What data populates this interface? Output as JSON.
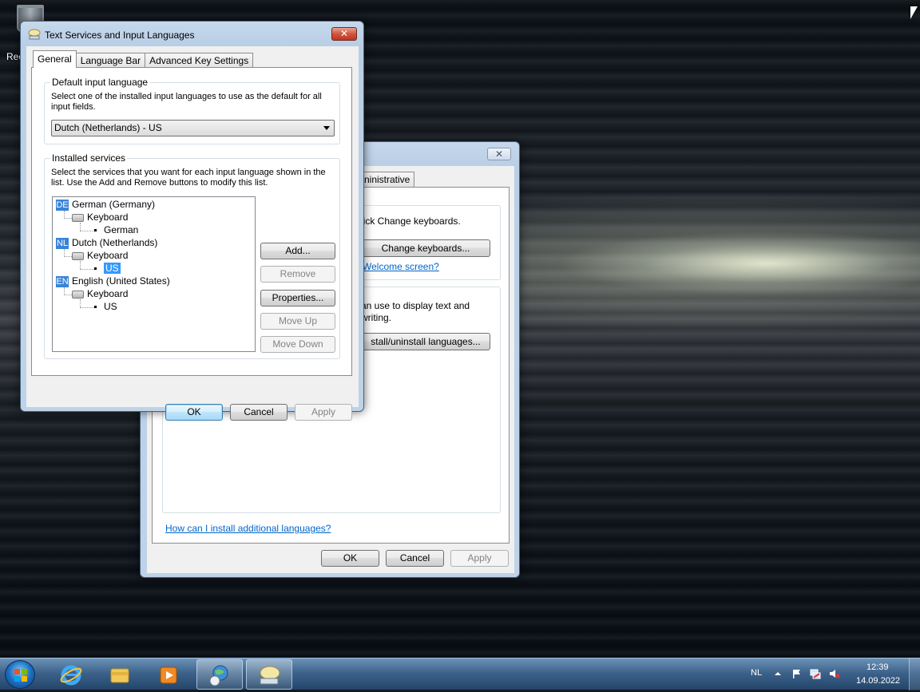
{
  "desktop": {
    "recycle_bin_label": "Rec"
  },
  "region_window": {
    "close_symbol": "✕",
    "visible_tab_fragment": "ninistrative",
    "section1_text": "lick Change keyboards.",
    "change_keyboards_label": "Change keyboards...",
    "welcome_link": "Welcome screen?",
    "section2_line1": "an use to display text and",
    "section2_line2": "writing.",
    "install_languages_label": "stall/uninstall languages...",
    "help_link": "How can I install additional languages?",
    "ok_label": "OK",
    "cancel_label": "Cancel",
    "apply_label": "Apply"
  },
  "text_services": {
    "title": "Text Services and Input Languages",
    "close_symbol": "✕",
    "tabs": [
      {
        "label": "General",
        "active": true
      },
      {
        "label": "Language Bar",
        "active": false
      },
      {
        "label": "Advanced Key Settings",
        "active": false
      }
    ],
    "default_input": {
      "legend": "Default input language",
      "description": "Select one of the installed input languages to use as the default for all input fields.",
      "selected": "Dutch (Netherlands) - US"
    },
    "installed_services": {
      "legend": "Installed services",
      "description": "Select the services that you want for each input language shown in the list. Use the Add and Remove buttons to modify this list.",
      "languages": [
        {
          "badge": "DE",
          "name": "German (Germany)",
          "category": "Keyboard",
          "layout": "German"
        },
        {
          "badge": "NL",
          "name": "Dutch (Netherlands)",
          "category": "Keyboard",
          "layout": "US"
        },
        {
          "badge": "EN",
          "name": "English (United States)",
          "category": "Keyboard",
          "layout": "US"
        }
      ],
      "buttons": {
        "add": "Add...",
        "remove": "Remove",
        "properties": "Properties...",
        "move_up": "Move Up",
        "move_down": "Move Down"
      }
    },
    "ok_label": "OK",
    "cancel_label": "Cancel",
    "apply_label": "Apply"
  },
  "taskbar": {
    "language_indicator": "NL",
    "clock_time": "12:39",
    "clock_date": "14.09.2022",
    "icons": [
      "windows-start-icon",
      "internet-explorer-icon",
      "file-explorer-icon",
      "media-player-icon",
      "region-language-icon",
      "text-services-icon"
    ],
    "tray_icons": [
      "show-hidden-icons-icon",
      "action-center-flag-icon",
      "network-icon",
      "volume-muted-icon"
    ]
  }
}
